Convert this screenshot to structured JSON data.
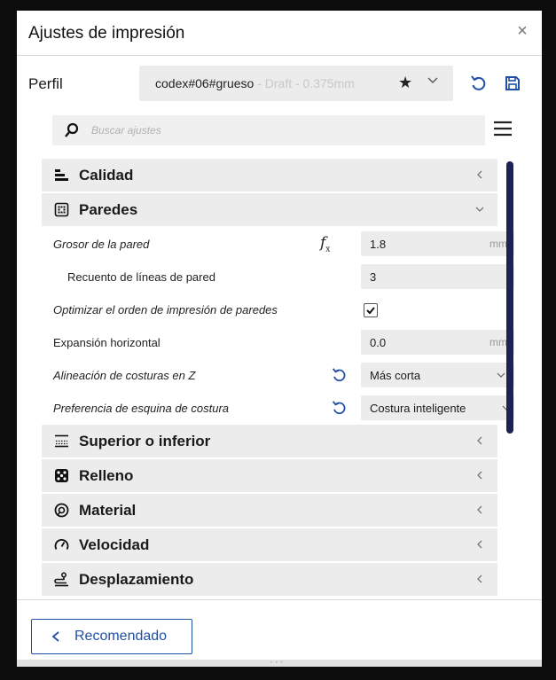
{
  "dialog": {
    "title": "Ajustes de impresión",
    "close_glyph": "×"
  },
  "profile": {
    "label": "Perfil",
    "name": "codex#06#grueso",
    "variant": " - Draft - 0.375mm",
    "favorite_glyph": "★"
  },
  "search": {
    "placeholder": "Buscar ajustes"
  },
  "sections": {
    "calidad": "Calidad",
    "paredes": "Paredes",
    "superior": "Superior o inferior",
    "relleno": "Relleno",
    "material": "Material",
    "velocidad": "Velocidad",
    "desplazamiento": "Desplazamiento"
  },
  "settings": {
    "wall_thickness": {
      "label": "Grosor de la pared",
      "value": "1.8",
      "unit": "mm"
    },
    "wall_line_count": {
      "label": "Recuento de líneas de pared",
      "value": "3"
    },
    "optimize_wall_order": {
      "label": "Optimizar el orden de impresión de paredes",
      "checked": true
    },
    "horizontal_expansion": {
      "label": "Expansión horizontal",
      "value": "0.0",
      "unit": "mm"
    },
    "z_seam_alignment": {
      "label": "Alineación de costuras en Z",
      "value": "Más corta"
    },
    "seam_corner_pref": {
      "label": "Preferencia de esquina de costura",
      "value": "Costura inteligente"
    }
  },
  "footer": {
    "recommended_label": "Recomendado",
    "grip": "• • •"
  },
  "colors": {
    "accent": "#1f4fa8",
    "scrollbar": "#1f2150",
    "field_bg": "#ececec"
  },
  "icons": [
    "close-icon",
    "star-icon",
    "chevron-down-icon",
    "reset-icon",
    "save-icon",
    "search-icon",
    "hamburger-menu-icon",
    "quality-icon",
    "walls-icon",
    "formula-icon",
    "top-bottom-icon",
    "infill-icon",
    "material-icon",
    "speed-icon",
    "travel-icon",
    "chevron-left-icon",
    "check-icon"
  ]
}
